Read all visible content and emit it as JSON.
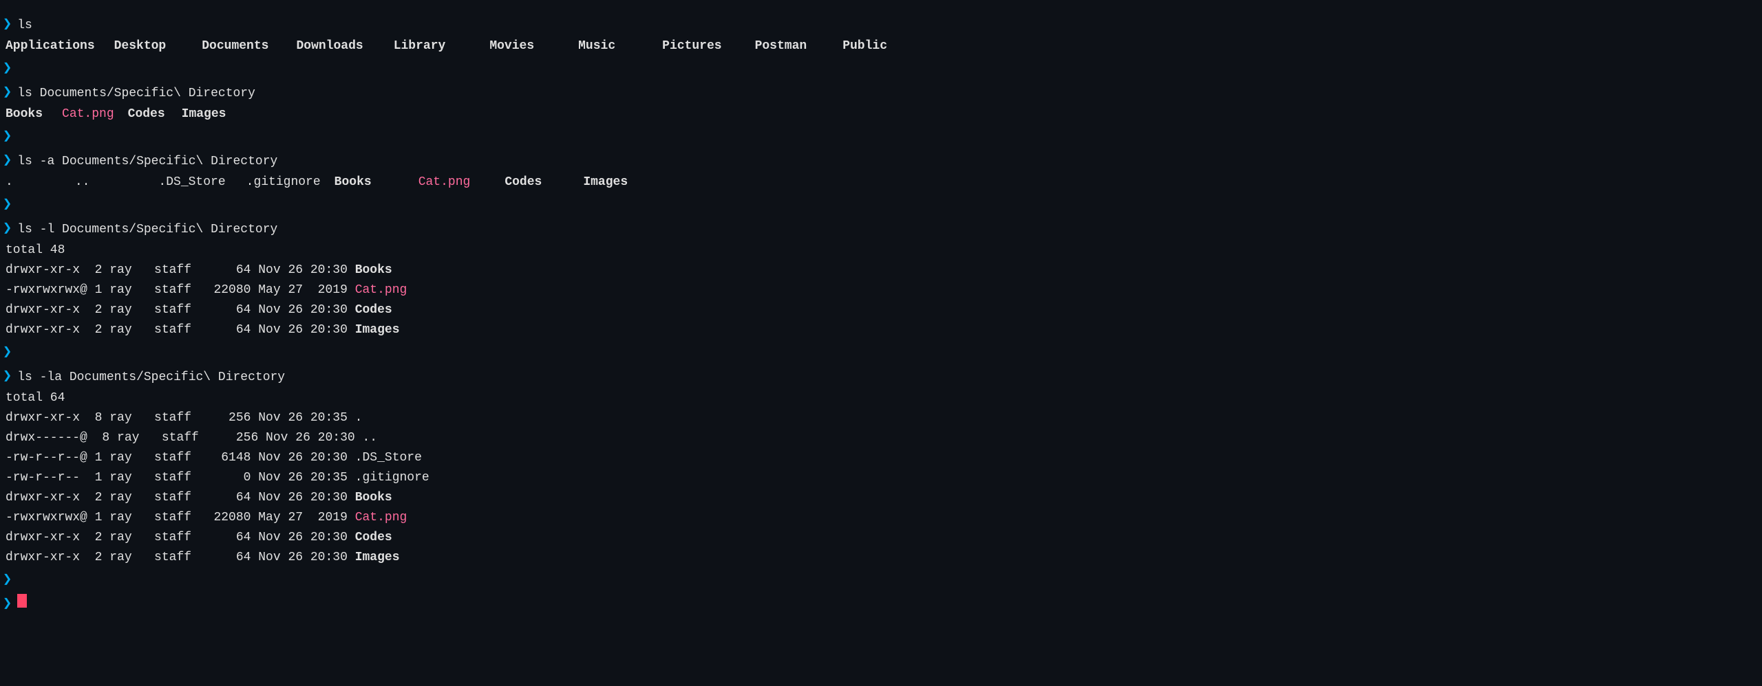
{
  "terminal": {
    "bg": "#0d1117",
    "prompt_arrow": "❯",
    "lines": [
      {
        "type": "prompt_block",
        "label": "prompt-1"
      },
      {
        "type": "command",
        "text": "ls"
      },
      {
        "type": "output",
        "items": [
          {
            "text": "Applications",
            "style": "dir"
          },
          {
            "text": "Desktop",
            "style": "dir"
          },
          {
            "text": "Documents",
            "style": "dir"
          },
          {
            "text": "Downloads",
            "style": "dir"
          },
          {
            "text": "Library",
            "style": "dir"
          },
          {
            "text": "Movies",
            "style": "dir"
          },
          {
            "text": "Music",
            "style": "dir"
          },
          {
            "text": "Pictures",
            "style": "dir"
          },
          {
            "text": "Postman",
            "style": "dir"
          },
          {
            "text": "Public",
            "style": "dir"
          }
        ]
      },
      {
        "type": "prompt_block",
        "label": "prompt-2"
      },
      {
        "type": "command",
        "text": "ls Documents/Specific\\ Directory"
      },
      {
        "type": "output_row",
        "items": [
          {
            "text": "Books",
            "style": "dir"
          },
          {
            "text": "Cat.png",
            "style": "file-pink"
          },
          {
            "text": "Codes",
            "style": "dir"
          },
          {
            "text": "Images",
            "style": "dir"
          }
        ]
      },
      {
        "type": "prompt_block",
        "label": "prompt-3"
      },
      {
        "type": "command",
        "text": "ls -a Documents/Specific\\ Directory"
      },
      {
        "type": "output_row_long",
        "items": [
          {
            "text": ".",
            "style": "normal"
          },
          {
            "text": "..",
            "style": "normal"
          },
          {
            "text": ".DS_Store",
            "style": "normal"
          },
          {
            "text": ".gitignore",
            "style": "normal"
          },
          {
            "text": "Books",
            "style": "dir"
          },
          {
            "text": "Cat.png",
            "style": "file-pink"
          },
          {
            "text": "Codes",
            "style": "dir"
          },
          {
            "text": "Images",
            "style": "dir"
          }
        ]
      },
      {
        "type": "prompt_block",
        "label": "prompt-4"
      },
      {
        "type": "command",
        "text": "ls -l Documents/Specific\\ Directory"
      },
      {
        "type": "total_line",
        "text": "total 48"
      },
      {
        "type": "ls_l_rows",
        "rows": [
          {
            "perms": "drwxr-xr-x",
            "links": "2",
            "user": "ray",
            "group": "staff",
            "size": "64",
            "month": "Nov",
            "day": "26",
            "time": "20:30",
            "name": "Books",
            "style": "dir"
          },
          {
            "perms": "-rwxrwxrwx@",
            "links": "1",
            "user": "ray",
            "group": "staff",
            "size": "22080",
            "month": "May",
            "day": "27",
            "time": "2019",
            "name": "Cat.png",
            "style": "file-pink"
          },
          {
            "perms": "drwxr-xr-x",
            "links": "2",
            "user": "ray",
            "group": "staff",
            "size": "64",
            "month": "Nov",
            "day": "26",
            "time": "20:30",
            "name": "Codes",
            "style": "dir"
          },
          {
            "perms": "drwxr-xr-x",
            "links": "2",
            "user": "ray",
            "group": "staff",
            "size": "64",
            "month": "Nov",
            "day": "26",
            "time": "20:30",
            "name": "Images",
            "style": "dir"
          }
        ]
      },
      {
        "type": "prompt_block",
        "label": "prompt-5"
      },
      {
        "type": "command",
        "text": "ls -la Documents/Specific\\ Directory"
      },
      {
        "type": "total_line",
        "text": "total 64"
      },
      {
        "type": "ls_la_rows",
        "rows": [
          {
            "perms": "drwxr-xr-x",
            "links": "8",
            "user": "ray",
            "group": "staff",
            "size": "256",
            "month": "Nov",
            "day": "26",
            "time": "20:35",
            "name": ".",
            "style": "normal"
          },
          {
            "perms": "drwx------@",
            "links": "8",
            "user": "ray",
            "group": "staff",
            "size": "256",
            "month": "Nov",
            "day": "26",
            "time": "20:30",
            "name": "..",
            "style": "normal"
          },
          {
            "perms": "-rw-r--r--@",
            "links": "1",
            "user": "ray",
            "group": "staff",
            "size": "6148",
            "month": "Nov",
            "day": "26",
            "time": "20:30",
            "name": ".DS_Store",
            "style": "normal"
          },
          {
            "perms": "-rw-r--r--",
            "links": "1",
            "user": "ray",
            "group": "staff",
            "size": "0",
            "month": "Nov",
            "day": "26",
            "time": "20:35",
            "name": ".gitignore",
            "style": "normal"
          },
          {
            "perms": "drwxr-xr-x",
            "links": "2",
            "user": "ray",
            "group": "staff",
            "size": "64",
            "month": "Nov",
            "day": "26",
            "time": "20:30",
            "name": "Books",
            "style": "dir"
          },
          {
            "perms": "-rwxrwxrwx@",
            "links": "1",
            "user": "ray",
            "group": "staff",
            "size": "22080",
            "month": "May",
            "day": "27",
            "time": "2019",
            "name": "Cat.png",
            "style": "file-pink"
          },
          {
            "perms": "drwxr-xr-x",
            "links": "2",
            "user": "ray",
            "group": "staff",
            "size": "64",
            "month": "Nov",
            "day": "26",
            "time": "20:30",
            "name": "Codes",
            "style": "dir"
          },
          {
            "perms": "drwxr-xr-x",
            "links": "2",
            "user": "ray",
            "group": "staff",
            "size": "64",
            "month": "Nov",
            "day": "26",
            "time": "20:30",
            "name": "Images",
            "style": "dir"
          }
        ]
      },
      {
        "type": "prompt_block",
        "label": "prompt-6"
      },
      {
        "type": "cursor"
      }
    ]
  }
}
